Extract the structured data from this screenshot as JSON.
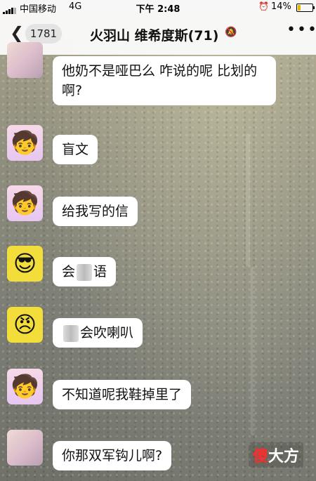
{
  "status_bar": {
    "carrier": "中国移动",
    "network": "4G",
    "time": "下午 2:48",
    "alarm_icon": "alarm-icon",
    "battery": "14%"
  },
  "header": {
    "back_icon": "chevron-left-icon",
    "unread_count": "1781",
    "title": "火羽山 维希度斯(71)",
    "mute_icon": "bell-muted-icon",
    "more_icon": "more-dots-icon"
  },
  "messages": [
    {
      "avatar": "photo",
      "sender": "",
      "text": "他奶不是哑巴么 咋说的呢 比划的啊?"
    },
    {
      "avatar": "crayon-shin",
      "sender": "",
      "text": "盲文"
    },
    {
      "avatar": "crayon-shin",
      "sender": "",
      "text": "给我写的信"
    },
    {
      "avatar": "yellow-emoji",
      "sender": "",
      "text_before": "会",
      "text_after": "语"
    },
    {
      "avatar": "yellow-emoji",
      "sender": "",
      "text_before": "",
      "text_after": "会吹喇叭"
    },
    {
      "avatar": "crayon-shin",
      "sender": "",
      "text": "不知道呢我鞋掉里了"
    },
    {
      "avatar": "photo",
      "sender": "",
      "text": "你那双军钩儿啊?"
    }
  ],
  "watermark": {
    "part1": "傻",
    "part2": "大方"
  }
}
